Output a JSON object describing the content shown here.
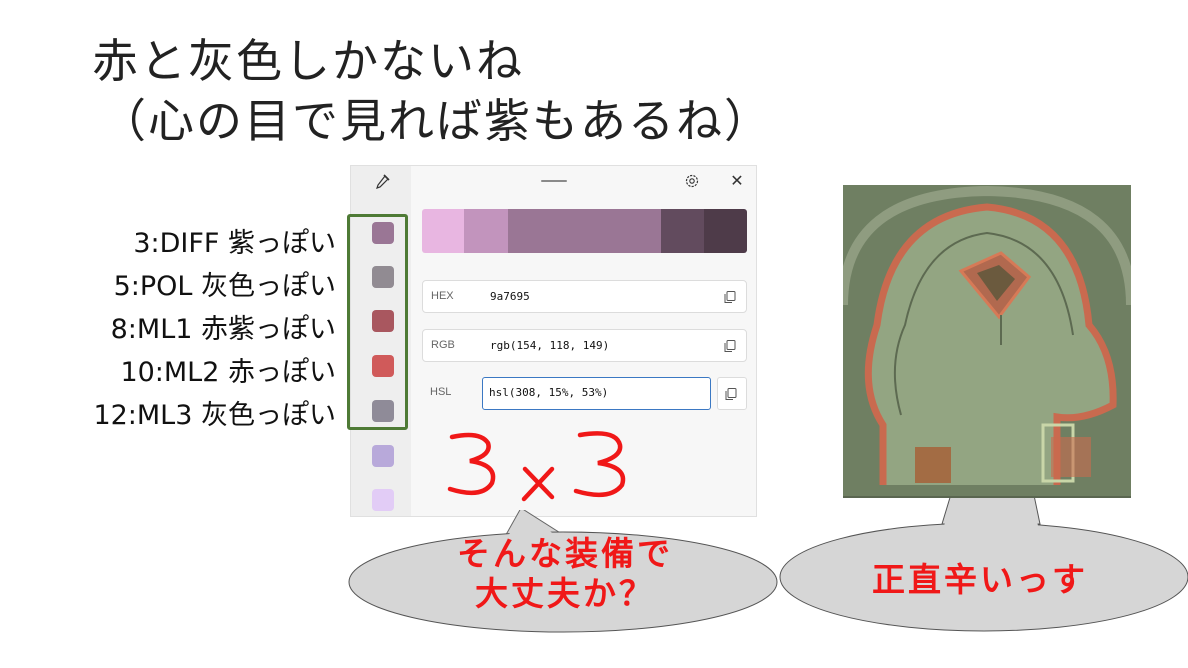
{
  "slide": {
    "title": "赤と灰色しかないね",
    "subtitle": "（心の目で見れば紫もあるね）",
    "layer_labels": [
      "3:DIFF 紫っぽい",
      "5:POL 灰色っぽい",
      "8:ML1 赤紫っぽい",
      "10:ML2 赤っぽい",
      "12:ML3 灰色っぽい"
    ],
    "handwritten_note": "3×3",
    "bubble_left": {
      "line1": "そんな装備で",
      "line2": "大丈夫か？"
    },
    "bubble_right": {
      "text": "正直辛いっす"
    }
  },
  "color_picker": {
    "history_swatches": [
      "#9a7695",
      "#918b92",
      "#a9575f",
      "#d05a5a",
      "#8f8b98",
      "#b8a9da",
      "#e2ccf6"
    ],
    "gradient_steps": [
      "#e8b6e1",
      "#c294bd",
      "#9a7695",
      "#7a5a76",
      "#624b5e",
      "#4e3b49"
    ],
    "fields": [
      {
        "label": "HEX",
        "value": "9a7695"
      },
      {
        "label": "RGB",
        "value": "rgb(154, 118, 149)"
      },
      {
        "label": "HSL",
        "value": "hsl(308, 15%, 53%)"
      }
    ],
    "icons": [
      "eyedropper-icon",
      "drag-handle-icon",
      "gear-icon",
      "close-icon",
      "copy-icon"
    ]
  },
  "colors": {
    "annotation_red": "#f01818",
    "frame_green": "#4e7a35",
    "bubble_fill": "#d6d6d6",
    "accent_blue": "#3b78c3"
  }
}
